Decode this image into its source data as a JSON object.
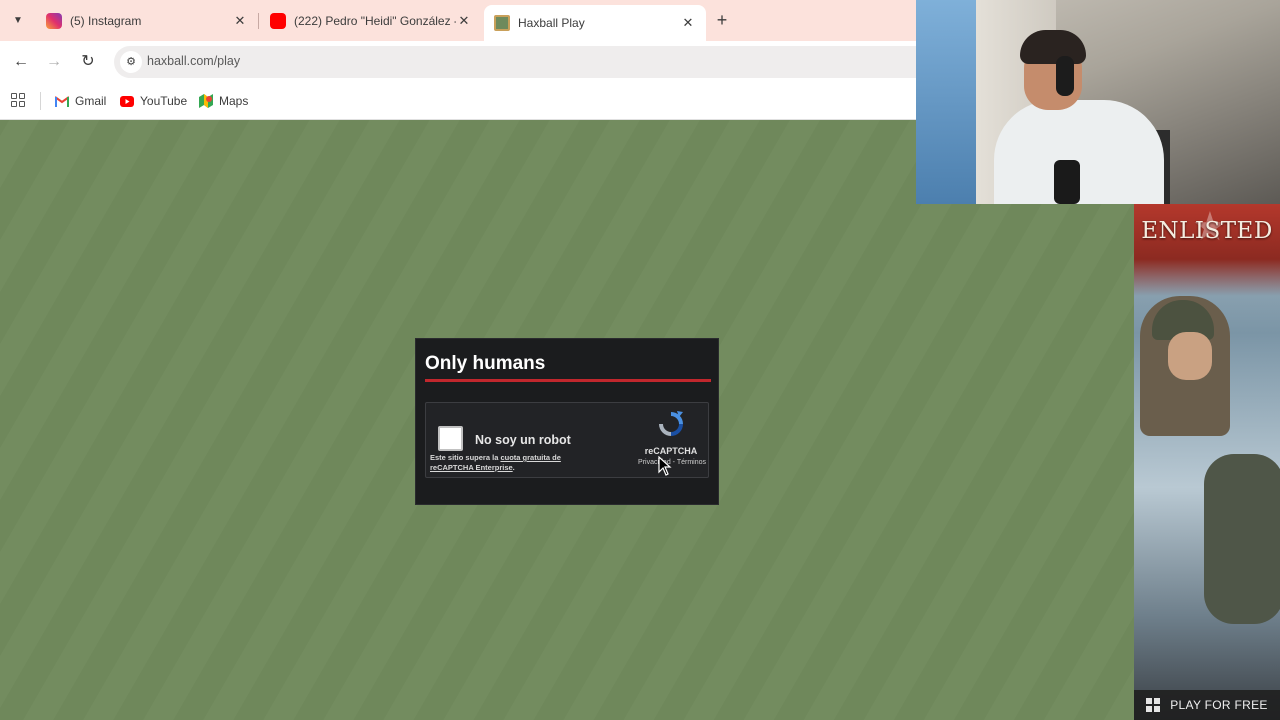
{
  "browser": {
    "tabs": [
      {
        "title": "(5) Instagram",
        "favicon": "instagram-icon",
        "active": false
      },
      {
        "title": "(222) Pedro \"Heidi\" González - ",
        "favicon": "youtube-icon",
        "active": false
      },
      {
        "title": "Haxball Play",
        "favicon": "haxball-icon",
        "active": true
      }
    ],
    "new_tab_label": "+",
    "address": "haxball.com/play",
    "bookmarks": [
      {
        "label": "Gmail",
        "icon": "gmail-icon"
      },
      {
        "label": "YouTube",
        "icon": "youtube-icon"
      },
      {
        "label": "Maps",
        "icon": "maps-icon"
      }
    ]
  },
  "dialog": {
    "title": "Only humans",
    "checkbox_label": "No soy un robot",
    "note_prefix": "Este sitio supera la ",
    "note_link": "cuota gratuita de reCAPTCHA Enterprise",
    "note_suffix": ".",
    "brand": "reCAPTCHA",
    "links": "Privacidad - Términos"
  },
  "ad": {
    "logo": "ENLISTED",
    "cta": "PLAY FOR FREE"
  },
  "colors": {
    "field_green": "#738c5f",
    "accent_red": "#c1272d",
    "tabstrip": "#fce2dc"
  }
}
